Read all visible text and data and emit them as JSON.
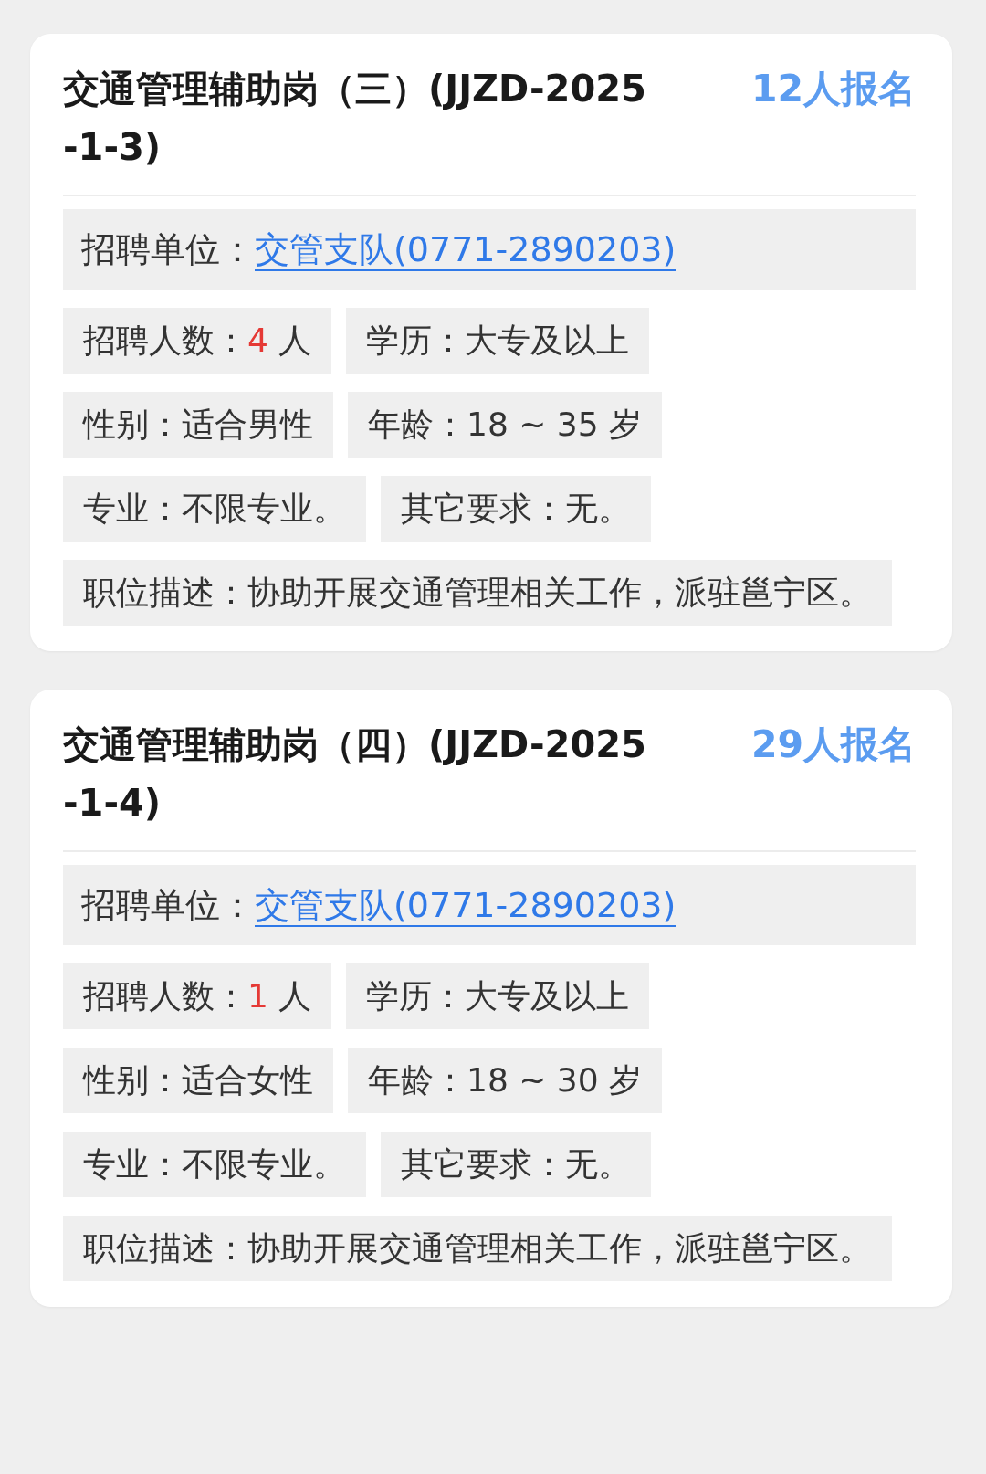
{
  "jobs": [
    {
      "title": "交通管理辅助岗（三）(JJZD-2025-1-3)",
      "applicants": "12人报名",
      "unit": {
        "label": "招聘单位：",
        "value": "交管支队(0771-2890203)"
      },
      "fields": [
        {
          "kind": "count",
          "label": "招聘人数：",
          "value": "4",
          "unit": "人"
        },
        {
          "kind": "plain",
          "label": "学历：",
          "value": "大专及以上"
        },
        {
          "kind": "plain",
          "label": "性别：",
          "value": "适合男性"
        },
        {
          "kind": "plain",
          "label": "年龄：",
          "value": "18 ~ 35 岁"
        },
        {
          "kind": "plain",
          "label": "专业：",
          "value": "不限专业。"
        },
        {
          "kind": "plain",
          "label": "其它要求：",
          "value": "无。"
        },
        {
          "kind": "wide",
          "label": "职位描述：",
          "value": "协助开展交通管理相关工作，派驻邕宁区。"
        }
      ]
    },
    {
      "title": "交通管理辅助岗（四）(JJZD-2025-1-4)",
      "applicants": "29人报名",
      "unit": {
        "label": "招聘单位：",
        "value": "交管支队(0771-2890203)"
      },
      "fields": [
        {
          "kind": "count",
          "label": "招聘人数：",
          "value": "1",
          "unit": "人"
        },
        {
          "kind": "plain",
          "label": "学历：",
          "value": "大专及以上"
        },
        {
          "kind": "plain",
          "label": "性别：",
          "value": "适合女性"
        },
        {
          "kind": "plain",
          "label": "年龄：",
          "value": "18 ~ 30 岁"
        },
        {
          "kind": "plain",
          "label": "专业：",
          "value": "不限专业。"
        },
        {
          "kind": "plain",
          "label": "其它要求：",
          "value": "无。"
        },
        {
          "kind": "wide",
          "label": "职位描述：",
          "value": "协助开展交通管理相关工作，派驻邕宁区。"
        }
      ]
    }
  ]
}
